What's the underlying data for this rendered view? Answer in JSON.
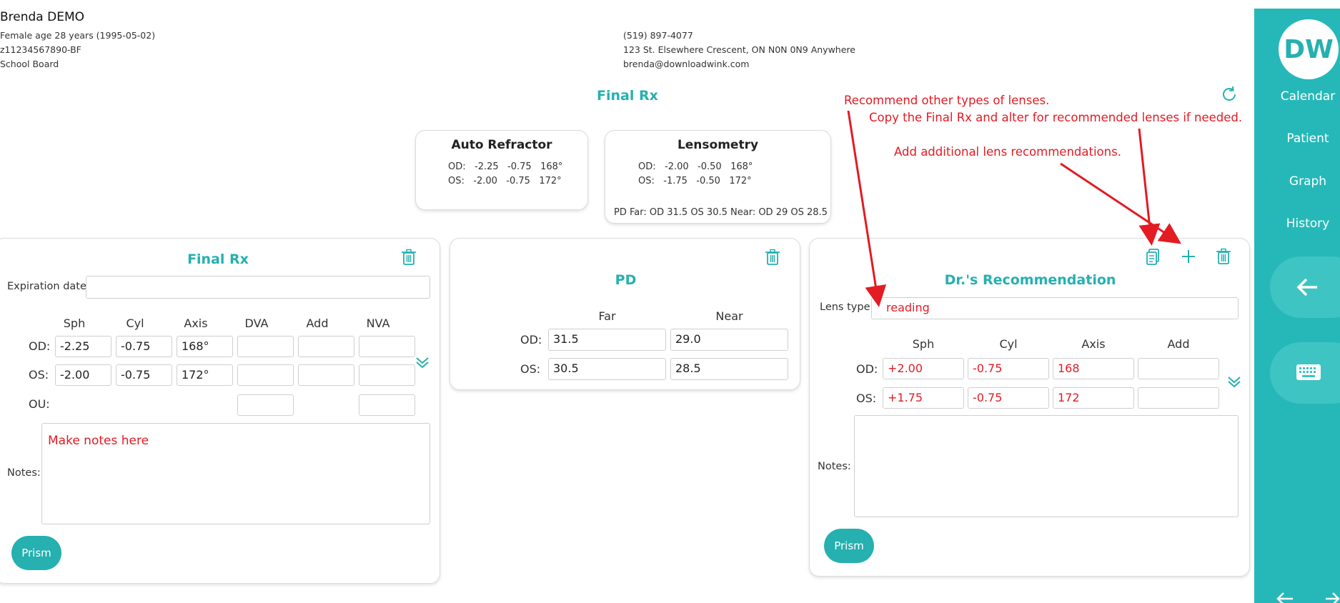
{
  "patient": {
    "name": "Brenda DEMO",
    "line1": "Female age 28 years  (1995-05-02)",
    "line2": "z11234567890-BF",
    "line3": "School Board",
    "phone": "(519) 897-4077",
    "address": "123 St. Elsewhere Crescent, ON N0N 0N9 Anywhere",
    "email": "brenda@downloadwink.com"
  },
  "page_title": "Final Rx",
  "auto_refractor": {
    "title": "Auto Refractor",
    "od": "OD:   -2.25   -0.75   168°",
    "os": "OS:   -2.00   -0.75   172°"
  },
  "lensometry": {
    "title": "Lensometry",
    "od": "OD:   -2.00   -0.50   168°",
    "os": "OS:   -1.75   -0.50   172°",
    "pd": "PD Far: OD 31.5 OS 30.5 Near: OD 29 OS 28.5"
  },
  "final_rx": {
    "title": "Final Rx",
    "expiration_label": "Expiration date:",
    "expiration_value": "",
    "columns": [
      "Sph",
      "Cyl",
      "Axis",
      "DVA",
      "Add",
      "NVA"
    ],
    "od_label": "OD:",
    "os_label": "OS:",
    "ou_label": "OU:",
    "od": [
      "-2.25",
      "-0.75",
      "168°",
      "",
      "",
      ""
    ],
    "os": [
      "-2.00",
      "-0.75",
      "172°",
      "",
      "",
      ""
    ],
    "notes_label": "Notes:",
    "notes": "Make notes here",
    "prism": "Prism"
  },
  "pd": {
    "title": "PD",
    "far": "Far",
    "near": "Near",
    "od_label": "OD:",
    "os_label": "OS:",
    "od_far": "31.5",
    "od_near": "29.0",
    "os_far": "30.5",
    "os_near": "28.5"
  },
  "recommendation": {
    "title": "Dr.'s Recommendation",
    "lens_type_label": "Lens type:",
    "lens_type": "reading",
    "columns": [
      "Sph",
      "Cyl",
      "Axis",
      "Add"
    ],
    "od_label": "OD:",
    "os_label": "OS:",
    "od": [
      "+2.00",
      "-0.75",
      "168",
      ""
    ],
    "os": [
      "+1.75",
      "-0.75",
      "172",
      ""
    ],
    "notes_label": "Notes:",
    "notes": "",
    "prism": "Prism"
  },
  "annotations": {
    "a1": "Recommend other types of lenses.",
    "a2": "Copy the Final Rx and alter for recommended lenses if needed.",
    "a3": "Add additional lens recommendations."
  },
  "sidebar": {
    "avatar": "DW",
    "items": [
      "Calendar",
      "Patient",
      "Graph",
      "History"
    ]
  },
  "colors": {
    "accent": "#26b0b0",
    "sidebar": "#26b8b8",
    "annotation": "#e31b23"
  }
}
